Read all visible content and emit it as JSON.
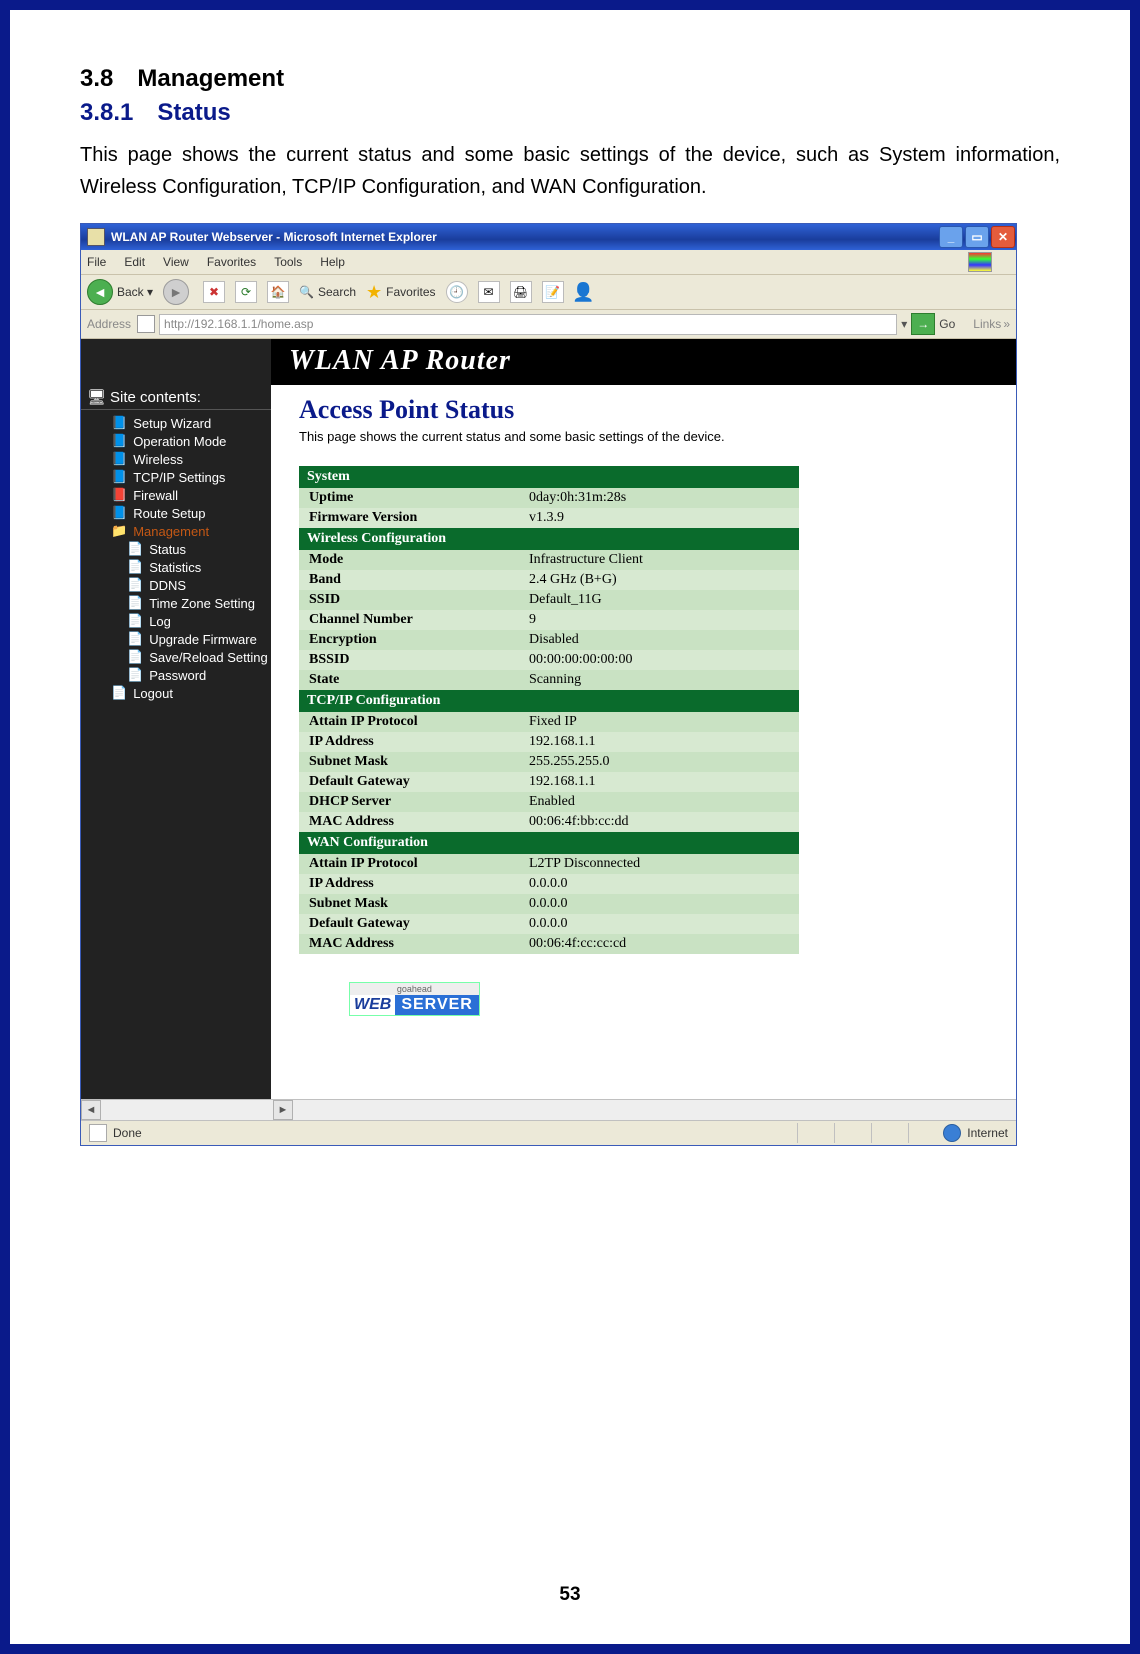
{
  "doc": {
    "section_number_title": "3.8 Management",
    "subsection_title": "3.8.1 Status",
    "paragraph": "This page shows the current status and some basic settings of the device, such as System information, Wireless Configuration, TCP/IP Configuration, and WAN Configuration.",
    "page_number": "53"
  },
  "window": {
    "title": "WLAN AP Router Webserver - Microsoft Internet Explorer",
    "menus": [
      "File",
      "Edit",
      "View",
      "Favorites",
      "Tools",
      "Help"
    ],
    "toolbar": {
      "back_label": "Back",
      "search_label": "Search",
      "favorites_label": "Favorites"
    },
    "address_label": "Address",
    "address_value": "http://192.168.1.1/home.asp",
    "go_label": "Go",
    "links_label": "Links",
    "status_text": "Done",
    "zone_text": "Internet"
  },
  "banner": "WLAN AP Router",
  "sidebar": {
    "title": "Site contents:",
    "items": [
      {
        "label": "Setup Wizard",
        "icon": "folder-blue"
      },
      {
        "label": "Operation Mode",
        "icon": "folder-blue"
      },
      {
        "label": "Wireless",
        "icon": "folder-blue"
      },
      {
        "label": "TCP/IP Settings",
        "icon": "folder-blue"
      },
      {
        "label": "Firewall",
        "icon": "folder-red"
      },
      {
        "label": "Route Setup",
        "icon": "folder-blue"
      }
    ],
    "management_label": "Management",
    "management_children": [
      "Status",
      "Statistics",
      "DDNS",
      "Time Zone Setting",
      "Log",
      "Upgrade Firmware",
      "Save/Reload Setting",
      "Password"
    ],
    "logout_label": "Logout"
  },
  "content": {
    "title": "Access Point Status",
    "subtitle": "This page shows the current status and some basic settings of the device.",
    "sections": [
      {
        "header": "System",
        "rows": [
          {
            "k": "Uptime",
            "v": "0day:0h:31m:28s"
          },
          {
            "k": "Firmware Version",
            "v": "v1.3.9"
          }
        ]
      },
      {
        "header": "Wireless Configuration",
        "rows": [
          {
            "k": "Mode",
            "v": "Infrastructure Client"
          },
          {
            "k": "Band",
            "v": "2.4 GHz (B+G)"
          },
          {
            "k": "SSID",
            "v": "Default_11G"
          },
          {
            "k": "Channel Number",
            "v": "9"
          },
          {
            "k": "Encryption",
            "v": "Disabled"
          },
          {
            "k": "BSSID",
            "v": "00:00:00:00:00:00"
          },
          {
            "k": "State",
            "v": "Scanning"
          }
        ]
      },
      {
        "header": "TCP/IP Configuration",
        "rows": [
          {
            "k": "Attain IP Protocol",
            "v": "Fixed IP"
          },
          {
            "k": "IP Address",
            "v": "192.168.1.1"
          },
          {
            "k": "Subnet Mask",
            "v": "255.255.255.0"
          },
          {
            "k": "Default Gateway",
            "v": "192.168.1.1"
          },
          {
            "k": "DHCP Server",
            "v": "Enabled"
          },
          {
            "k": "MAC Address",
            "v": "00:06:4f:bb:cc:dd"
          }
        ]
      },
      {
        "header": "WAN Configuration",
        "rows": [
          {
            "k": "Attain IP Protocol",
            "v": "L2TP Disconnected"
          },
          {
            "k": "IP Address",
            "v": "0.0.0.0"
          },
          {
            "k": "Subnet Mask",
            "v": "0.0.0.0"
          },
          {
            "k": "Default Gateway",
            "v": "0.0.0.0"
          },
          {
            "k": "MAC Address",
            "v": "00:06:4f:cc:cc:cd"
          }
        ]
      }
    ],
    "badge_top": "goahead",
    "badge_web": "WEB",
    "badge_server": "SERVER"
  }
}
